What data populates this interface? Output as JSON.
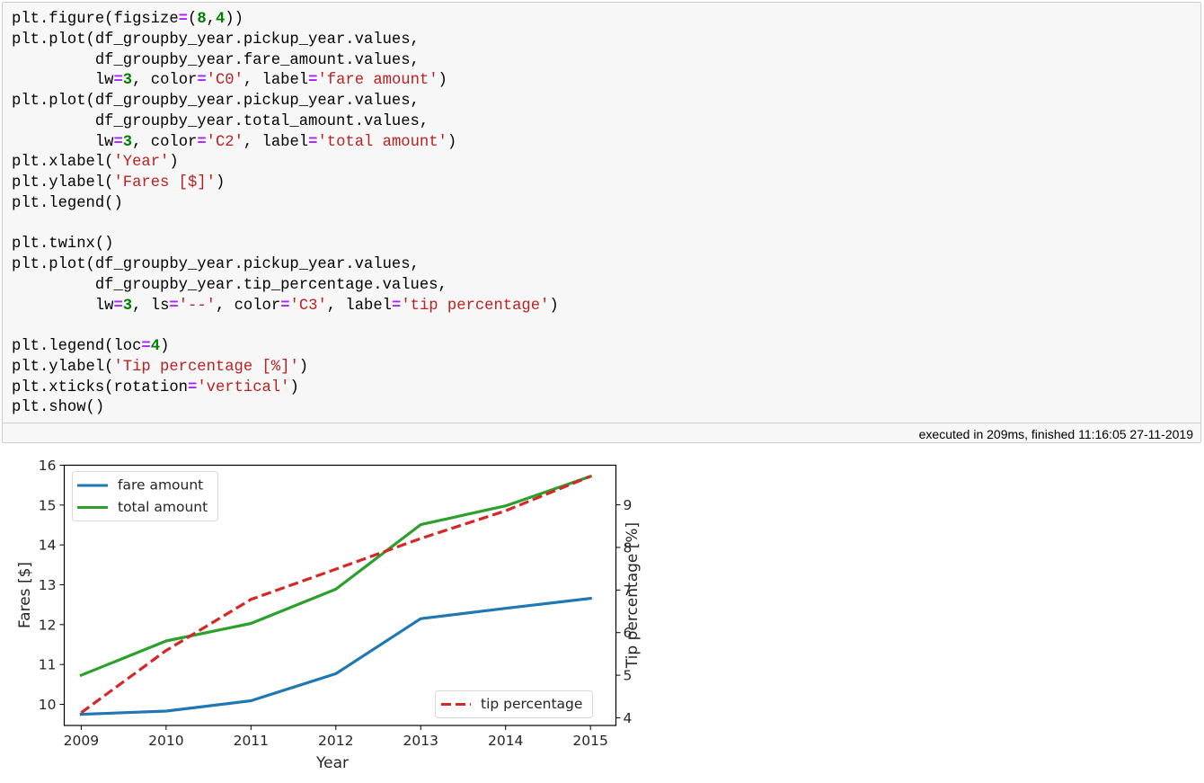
{
  "cell": {
    "code_lines": [
      [
        [
          "plt.figure(figsize",
          ""
        ],
        [
          "=",
          "op"
        ],
        [
          "(",
          ""
        ],
        [
          "8",
          "num"
        ],
        [
          ",",
          ""
        ],
        [
          "4",
          "num"
        ],
        [
          "))",
          ""
        ]
      ],
      [
        [
          "plt.plot(df_groupby_year.pickup_year.values,",
          ""
        ]
      ],
      [
        [
          "         df_groupby_year.fare_amount.values,",
          ""
        ]
      ],
      [
        [
          "         lw",
          ""
        ],
        [
          "=",
          "op"
        ],
        [
          "3",
          "num"
        ],
        [
          ", color",
          ""
        ],
        [
          "=",
          "op"
        ],
        [
          "'C0'",
          "str"
        ],
        [
          ", label",
          ""
        ],
        [
          "=",
          "op"
        ],
        [
          "'fare amount'",
          "str"
        ],
        [
          ")",
          ""
        ]
      ],
      [
        [
          "plt.plot(df_groupby_year.pickup_year.values,",
          ""
        ]
      ],
      [
        [
          "         df_groupby_year.total_amount.values,",
          ""
        ]
      ],
      [
        [
          "         lw",
          ""
        ],
        [
          "=",
          "op"
        ],
        [
          "3",
          "num"
        ],
        [
          ", color",
          ""
        ],
        [
          "=",
          "op"
        ],
        [
          "'C2'",
          "str"
        ],
        [
          ", label",
          ""
        ],
        [
          "=",
          "op"
        ],
        [
          "'total amount'",
          "str"
        ],
        [
          ")",
          ""
        ]
      ],
      [
        [
          "plt.xlabel(",
          ""
        ],
        [
          "'Year'",
          "str"
        ],
        [
          ")",
          ""
        ]
      ],
      [
        [
          "plt.ylabel(",
          ""
        ],
        [
          "'Fares [$]'",
          "str"
        ],
        [
          ")",
          ""
        ]
      ],
      [
        [
          "plt.legend()",
          ""
        ]
      ],
      [
        [
          "",
          ""
        ]
      ],
      [
        [
          "plt.twinx()",
          ""
        ]
      ],
      [
        [
          "plt.plot(df_groupby_year.pickup_year.values,",
          ""
        ]
      ],
      [
        [
          "         df_groupby_year.tip_percentage.values,",
          ""
        ]
      ],
      [
        [
          "         lw",
          ""
        ],
        [
          "=",
          "op"
        ],
        [
          "3",
          "num"
        ],
        [
          ", ls",
          ""
        ],
        [
          "=",
          "op"
        ],
        [
          "'--'",
          "str"
        ],
        [
          ", color",
          ""
        ],
        [
          "=",
          "op"
        ],
        [
          "'C3'",
          "str"
        ],
        [
          ", label",
          ""
        ],
        [
          "=",
          "op"
        ],
        [
          "'tip percentage'",
          "str"
        ],
        [
          ")",
          ""
        ]
      ],
      [
        [
          "",
          ""
        ]
      ],
      [
        [
          "plt.legend(loc",
          ""
        ],
        [
          "=",
          "op"
        ],
        [
          "4",
          "num"
        ],
        [
          ")",
          ""
        ]
      ],
      [
        [
          "plt.ylabel(",
          ""
        ],
        [
          "'Tip percentage [%]'",
          "str"
        ],
        [
          ")",
          ""
        ]
      ],
      [
        [
          "plt.xticks(rotation",
          ""
        ],
        [
          "=",
          "op"
        ],
        [
          "'vertical'",
          "str"
        ],
        [
          ")",
          ""
        ]
      ],
      [
        [
          "plt.show()",
          ""
        ]
      ]
    ],
    "execution_info": "executed in 209ms, finished 11:16:05 27-11-2019"
  },
  "chart_data": {
    "type": "line",
    "title": "",
    "x": [
      2009,
      2010,
      2011,
      2012,
      2013,
      2014,
      2015
    ],
    "xlabel": "Year",
    "xticks": [
      "2009",
      "2010",
      "2011",
      "2012",
      "2013",
      "2014",
      "2015"
    ],
    "xlim": [
      2008.8,
      2015.3
    ],
    "grid": false,
    "left_axis": {
      "ylabel": "Fares [$]",
      "ylim": [
        9.47,
        16.0
      ],
      "yticks": [
        "10",
        "11",
        "12",
        "13",
        "14",
        "15",
        "16"
      ],
      "legend_loc": "top-left",
      "series": [
        {
          "name": "fare amount",
          "color": "#1f77b4",
          "linestyle": "solid",
          "values": [
            9.75,
            9.83,
            10.09,
            10.77,
            12.15,
            12.41,
            12.66
          ]
        },
        {
          "name": "total amount",
          "color": "#2ca02c",
          "linestyle": "solid",
          "values": [
            10.73,
            11.59,
            12.03,
            12.89,
            14.51,
            14.98,
            15.72
          ]
        }
      ]
    },
    "right_axis": {
      "ylabel": "Tip percentage [%]",
      "ylim": [
        3.82,
        9.93
      ],
      "yticks": [
        "4",
        "5",
        "6",
        "7",
        "8",
        "9"
      ],
      "legend_loc": "bottom-right",
      "series": [
        {
          "name": "tip percentage",
          "color": "#d62728",
          "linestyle": "dashed",
          "values": [
            4.12,
            5.58,
            6.78,
            7.49,
            8.21,
            8.86,
            9.67
          ]
        }
      ]
    }
  }
}
